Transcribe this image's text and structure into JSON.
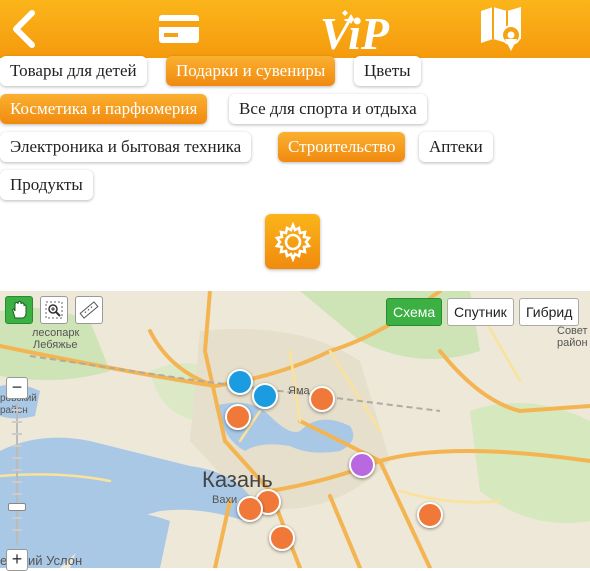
{
  "topbar": {
    "back_icon": "chevron-left-icon",
    "card_icon": "credit-card-icon",
    "logo_text": "ViP",
    "map_icon": "map-pin-icon"
  },
  "categories": [
    {
      "label": "Товары для детей",
      "active": false
    },
    {
      "label": "Подарки и сувениры",
      "active": true
    },
    {
      "label": "Цветы",
      "active": false
    },
    {
      "label": "Косметика и парфюмерия",
      "active": true
    },
    {
      "label": "Все для спорта и отдыха",
      "active": false
    },
    {
      "label": "Электроника и бытовая техника",
      "active": false
    },
    {
      "label": "Строительство",
      "active": true
    },
    {
      "label": "Аптеки",
      "active": false
    },
    {
      "label": "Продукты",
      "active": false
    }
  ],
  "settings_icon": "gear-icon",
  "map": {
    "tools": [
      "hand-drag-icon",
      "zoom-area-icon",
      "ruler-icon"
    ],
    "types": [
      {
        "label": "Схема",
        "active": true
      },
      {
        "label": "Спутник",
        "active": false
      },
      {
        "label": "Гибрид",
        "active": false
      }
    ],
    "zoom_in": "+",
    "zoom_out": "−",
    "zoom_level": 0.73,
    "labels": {
      "city": "Казань",
      "park1": "лесопарк",
      "park2": "Лебяжье",
      "district1": "Совет",
      "district2": "район",
      "yama": "Яма",
      "bottom_left": "ерхний Услон",
      "vakh": "Вахи",
      "left_edge1": "ровский",
      "left_edge2": "район"
    },
    "markers": [
      {
        "color": "#1b9ce0",
        "kind": "blue"
      },
      {
        "color": "#1b9ce0",
        "kind": "blue"
      },
      {
        "color": "#f07838",
        "kind": "orange"
      },
      {
        "color": "#f07838",
        "kind": "orange"
      },
      {
        "color": "#b869e0",
        "kind": "purple"
      },
      {
        "color": "#f07838",
        "kind": "orange"
      },
      {
        "color": "#f07838",
        "kind": "orange"
      },
      {
        "color": "#f07838",
        "kind": "orange"
      },
      {
        "color": "#f07838",
        "kind": "orange"
      }
    ]
  }
}
